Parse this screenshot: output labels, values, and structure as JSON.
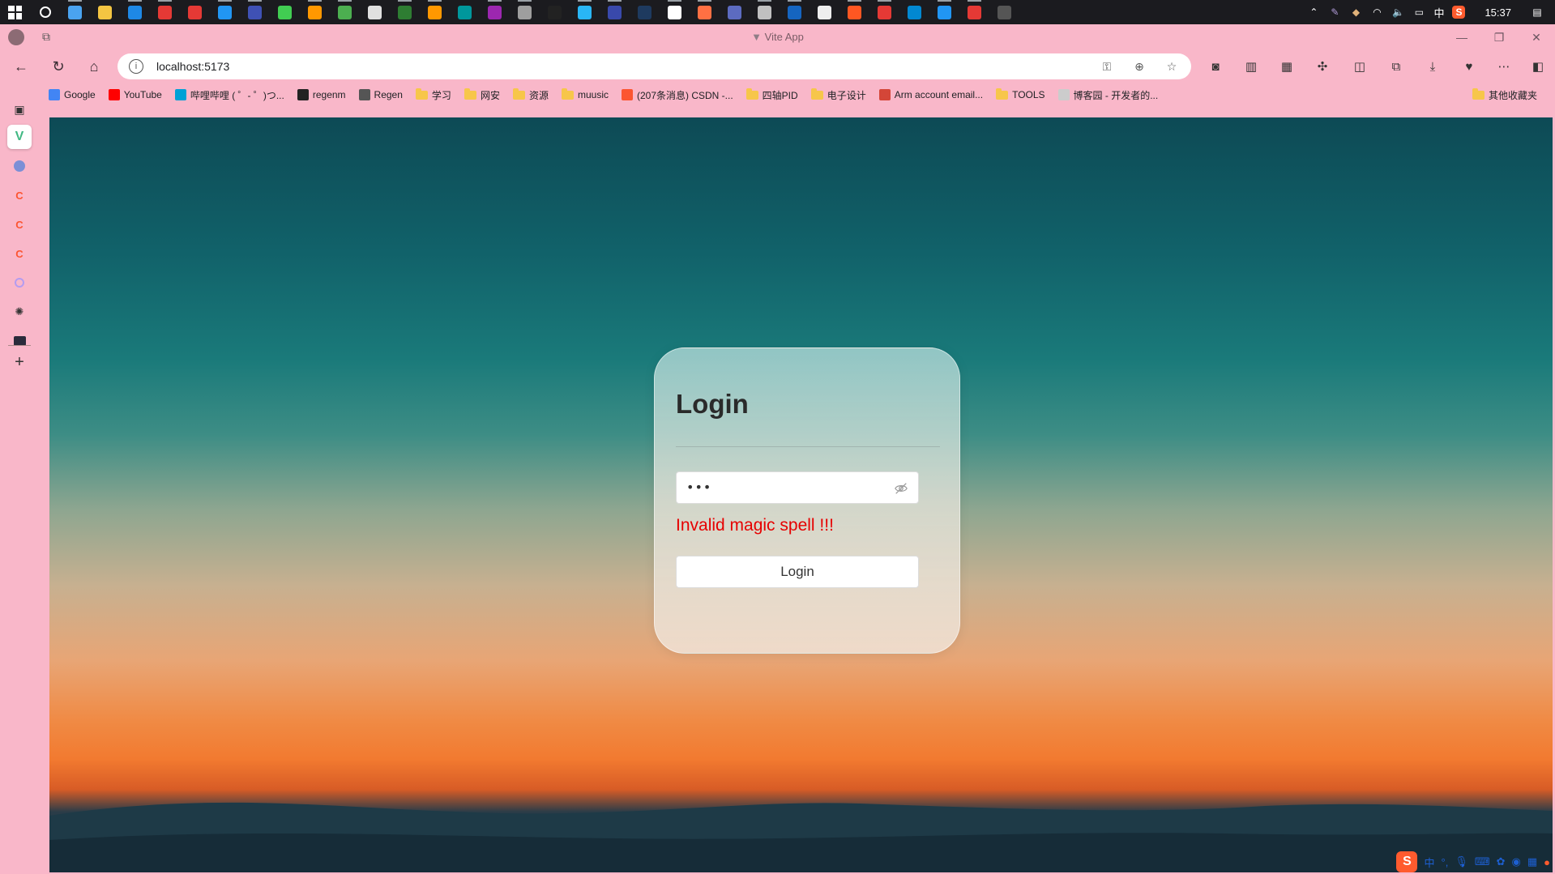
{
  "taskbar": {
    "apps": [
      {
        "name": "windows-start-icon",
        "color": "#ffffff"
      },
      {
        "name": "search-icon",
        "color": "#ffffff"
      },
      {
        "name": "desktop-icon",
        "color": "#4aa3f0"
      },
      {
        "name": "file-explorer-icon",
        "color": "#f4c542"
      },
      {
        "name": "edge-icon",
        "color": "#1e88e5"
      },
      {
        "name": "wps-icon",
        "color": "#e53935"
      },
      {
        "name": "xmind-icon",
        "color": "#e53935"
      },
      {
        "name": "vscode-icon",
        "color": "#2196f3"
      },
      {
        "name": "intellij-icon",
        "color": "#3f51b5"
      },
      {
        "name": "qt-icon",
        "color": "#41cd52"
      },
      {
        "name": "tool-icon",
        "color": "#ff9800"
      },
      {
        "name": "wechat-icon",
        "color": "#4caf50"
      },
      {
        "name": "notepad-icon",
        "color": "#e0e0e0"
      },
      {
        "name": "sheet-icon",
        "color": "#2e7d32"
      },
      {
        "name": "app-icon-orange",
        "color": "#ff9800"
      },
      {
        "name": "arduino-icon",
        "color": "#00979c"
      },
      {
        "name": "app-icon-purple",
        "color": "#9c27b0"
      },
      {
        "name": "app-icon-grey",
        "color": "#9e9e9e"
      },
      {
        "name": "qq-icon",
        "color": "#222222"
      },
      {
        "name": "telegram-icon",
        "color": "#29b6f6"
      },
      {
        "name": "app-icon-dark",
        "color": "#3949ab"
      },
      {
        "name": "steam-icon",
        "color": "#1e3a5f"
      },
      {
        "name": "typora-icon",
        "color": "#ffffff"
      },
      {
        "name": "fox-icon",
        "color": "#ff7043"
      },
      {
        "name": "browser-icon",
        "color": "#5c6bc0"
      },
      {
        "name": "pdf-icon",
        "color": "#c0c0c0"
      },
      {
        "name": "mx-icon",
        "color": "#1565c0"
      },
      {
        "name": "cloud-icon",
        "color": "#eeeeee"
      },
      {
        "name": "app-icon-red",
        "color": "#ff5722"
      },
      {
        "name": "netease-icon",
        "color": "#e53935"
      },
      {
        "name": "store-icon",
        "color": "#0288d1"
      },
      {
        "name": "vscode-2-icon",
        "color": "#2196f3"
      },
      {
        "name": "xmind-2-icon",
        "color": "#e53935"
      },
      {
        "name": "terminal-icon",
        "color": "#555555"
      }
    ],
    "clock": "15:37",
    "ime_lang": "中"
  },
  "browser": {
    "title": "Vite App",
    "url": "localhost:5173",
    "bookmarks": [
      {
        "label": "Google",
        "type": "site",
        "color": "#4285f4"
      },
      {
        "label": "YouTube",
        "type": "site",
        "color": "#ff0000"
      },
      {
        "label": "哔哩哔哩 ( ゜- ゜)つ...",
        "type": "site",
        "color": "#00a1d6"
      },
      {
        "label": "regenm",
        "type": "site",
        "color": "#222222"
      },
      {
        "label": "Regen",
        "type": "site",
        "color": "#555555"
      },
      {
        "label": "学习",
        "type": "folder"
      },
      {
        "label": "网安",
        "type": "folder"
      },
      {
        "label": "资源",
        "type": "folder"
      },
      {
        "label": "muusic",
        "type": "folder"
      },
      {
        "label": "(207条消息) CSDN -...",
        "type": "site",
        "color": "#fc5531"
      },
      {
        "label": "四轴PID",
        "type": "folder"
      },
      {
        "label": "电子设计",
        "type": "folder"
      },
      {
        "label": "Arm account email...",
        "type": "site",
        "color": "#d44638"
      },
      {
        "label": "TOOLS",
        "type": "folder"
      },
      {
        "label": "博客园 - 开发者的...",
        "type": "site",
        "color": "#cccccc"
      }
    ],
    "other_bookmarks": "其他收藏夹"
  },
  "login": {
    "title": "Login",
    "password_value": "•••",
    "error_message": "Invalid magic spell !!!",
    "button_label": "Login"
  },
  "ime_bar": {
    "lang": "中"
  }
}
